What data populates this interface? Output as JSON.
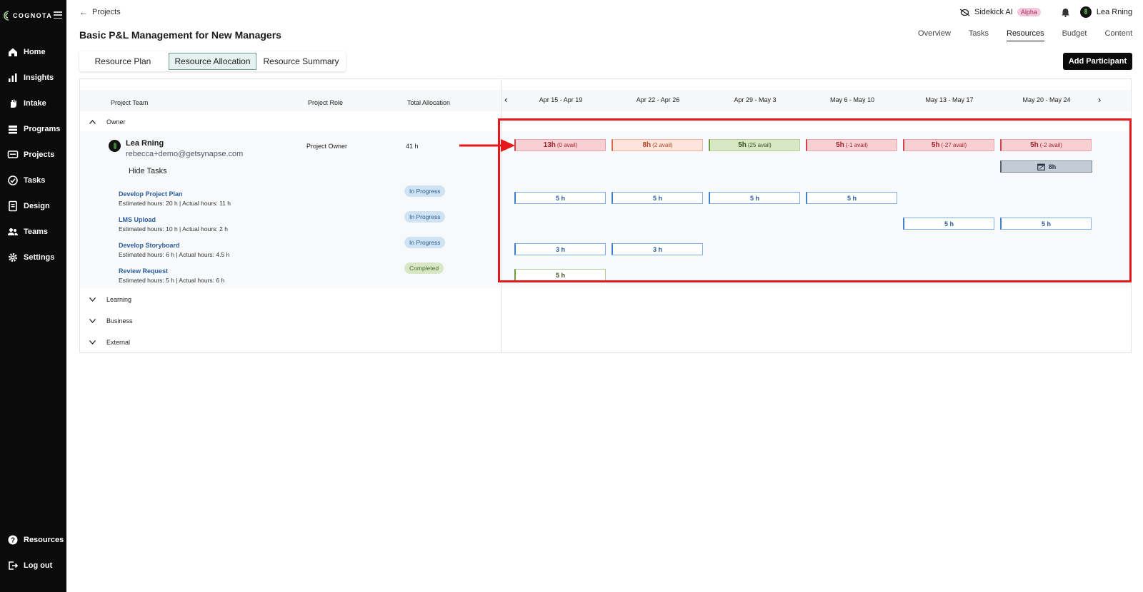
{
  "brand": {
    "name": "COGNOTA"
  },
  "sidebar": {
    "items": [
      {
        "label": "Home",
        "icon": "home-icon"
      },
      {
        "label": "Insights",
        "icon": "bar-chart-icon"
      },
      {
        "label": "Intake",
        "icon": "hand-icon"
      },
      {
        "label": "Programs",
        "icon": "stack-icon"
      },
      {
        "label": "Projects",
        "icon": "monitor-icon"
      },
      {
        "label": "Tasks",
        "icon": "check-circle-icon"
      },
      {
        "label": "Design",
        "icon": "document-icon"
      },
      {
        "label": "Teams",
        "icon": "users-icon"
      },
      {
        "label": "Settings",
        "icon": "gear-icon"
      }
    ],
    "bottom_items": [
      {
        "label": "Resources",
        "icon": "help-circle-icon"
      },
      {
        "label": "Log out",
        "icon": "logout-icon"
      }
    ]
  },
  "header": {
    "back_label": "Projects",
    "title": "Basic P&L Management for New Managers",
    "sidekick_label": "Sidekick AI",
    "alpha_badge": "Alpha",
    "user_name": "Lea Rning",
    "nav_tabs": [
      "Overview",
      "Tasks",
      "Resources",
      "Budget",
      "Content"
    ],
    "active_nav": "Resources",
    "add_button": "Add Participant"
  },
  "view_tabs": {
    "items": [
      "Resource Plan",
      "Resource Allocation",
      "Resource Summary"
    ],
    "active": "Resource Allocation"
  },
  "table": {
    "columns": {
      "team": "Project Team",
      "role": "Project Role",
      "total": "Total Allocation"
    },
    "weeks": [
      "Apr 15 - Apr 19",
      "Apr 22 - Apr 26",
      "Apr 29 - May 3",
      "May 6 - May 10",
      "May 13 - May 17",
      "May 20 - May 24"
    ],
    "groups": [
      "Owner",
      "Learning",
      "Business",
      "External"
    ],
    "member": {
      "name": "Lea Rning",
      "email": "rebecca+demo@getsynapse.com",
      "role": "Project Owner",
      "total": "41 h",
      "hide_tasks_label": "Hide Tasks",
      "allocations": [
        {
          "hours": "13h",
          "avail": "(0 avail)",
          "status": "over"
        },
        {
          "hours": "8h",
          "avail": "(2 avail)",
          "status": "near"
        },
        {
          "hours": "5h",
          "avail": "(25 avail)",
          "status": "ok"
        },
        {
          "hours": "5h",
          "avail": "(-1 avail)",
          "status": "over"
        },
        {
          "hours": "5h",
          "avail": "(-27 avail)",
          "status": "over"
        },
        {
          "hours": "5h",
          "avail": "(-2 avail)",
          "status": "over"
        }
      ],
      "time_off": {
        "label": "8h",
        "icon": "calendar-icon",
        "week": 5
      }
    },
    "tasks": [
      {
        "name": "Develop Project Plan",
        "meta": "Estimated hours: 20 h | Actual hours: 11 h",
        "status": "In Progress",
        "bars": [
          "5 h",
          "5 h",
          "5 h",
          "5 h",
          "",
          ""
        ]
      },
      {
        "name": "LMS Upload",
        "meta": "Estimated hours: 10 h | Actual hours: 2 h",
        "status": "In Progress",
        "bars": [
          "",
          "",
          "",
          "",
          "5 h",
          "5 h"
        ]
      },
      {
        "name": "Develop Storyboard",
        "meta": "Estimated hours: 6 h | Actual hours: 4.5 h",
        "status": "In Progress",
        "bars": [
          "3 h",
          "3 h",
          "",
          "",
          "",
          ""
        ]
      },
      {
        "name": "Review Request",
        "meta": "Estimated hours: 5 h | Actual hours: 6 h",
        "status": "Completed",
        "bars": [
          "5 h",
          "",
          "",
          "",
          "",
          ""
        ]
      }
    ]
  },
  "colors": {
    "accent_red": "#e3191c",
    "sidebar_bg": "#0b0b0b",
    "active_tab_bg": "#e6f2ef"
  }
}
